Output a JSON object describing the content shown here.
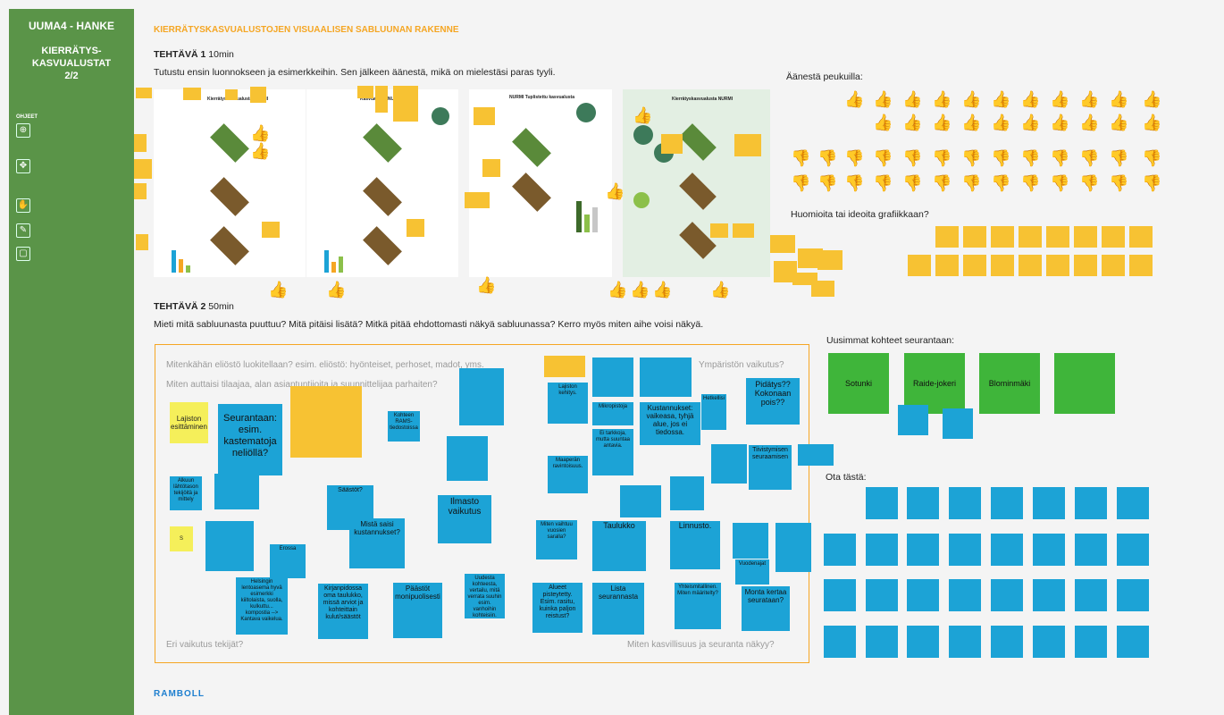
{
  "sidebar": {
    "title": "UUMA4 - HANKE",
    "subtitle_line1": "KIERRÄTYS-",
    "subtitle_line2": "KASVUALUSTAT",
    "subtitle_line3": "2/2",
    "ohjeet": "OHJEET"
  },
  "header": {
    "title": "KIERRÄTYSKASVUALUSTOJEN VISUAALISEN SABLUUNAN RAKENNE"
  },
  "task1": {
    "label": "TEHTÄVÄ 1",
    "time": "10min",
    "instruction": "Tutustu ensin luonnokseen ja esimerkkeihin. Sen jälkeen äänestä, mikä on mielestäsi paras tyyli."
  },
  "task2": {
    "label": "TEHTÄVÄ 2",
    "time": "50min",
    "instruction": "Mieti mitä sabluunasta puuttuu? Mitä pitäisi lisätä? Mitkä pitää ehdottomasti näkyä sabluunassa? Kerro myös miten aihe voisi näkyä."
  },
  "right": {
    "vote_label": "Äänestä peukuilla:",
    "ideas_label": "Huomioita tai ideoita grafiikkaan?",
    "tracking_label": "Uusimmat kohteet seurantaan:",
    "take_label": "Ota tästä:",
    "green_notes": [
      "Sotunki",
      "Raide-jokeri",
      "Blominmäki"
    ]
  },
  "task2_hints": {
    "h1": "Mitenkähän eliöstö luokitellaan? esim. eliöstö: hyönteiset, perhoset, madot, yms.",
    "h2": "Ympäristön vaikutus?",
    "h3": "Miten auttaisi tilaajaa, alan asiantuntijoita ja suunnittelijaa parhaiten?",
    "h4": "Eri vaikutus tekijät?",
    "h5": "Miten kasvillisuus ja seuranta näkyy?"
  },
  "task2_notes": {
    "lajiston": "Lajiston esittäminen",
    "seurantaan": "Seurantaan: esim. kastematoja neliöllä?",
    "ilmasto": "Ilmasto vaikutus",
    "mista": "Mistä saisi kustannukset?",
    "paastot": "Päästöt monipuolisesti",
    "kirjanpidossa": "Kirjanpidossa oma taulukko, missä arviot ja kohteittain kulut/säästöt",
    "alueet": "Alueet pisteytetty. Esim. rasitu, kuinka paljon reistust?",
    "lista": "Lista seurannasta",
    "taulukko": "Taulukko",
    "linnusto": "Linnusto.",
    "monta": "Monta kertaa seurataan?",
    "kustannukset": "Kustannukset: vaikeasa, tyhjä alue, jos ei tiedossa.",
    "pidatys": "Pidätys?? Kokonaan pois??",
    "saastot": "Säästöt?",
    "helsingin": "Helsingin lentoasema hyvä esimerkki kiiltolaista, suolla, kulkuttu... kompostia --> Kantava vaikelua.",
    "lajiston_kehitys": "Lajiston kehitys.",
    "maaperan": "Maaperän ravintoisuus.",
    "mikropistoja": "Mikropistoja",
    "tiivistymisen": "Tiivistymisen seuraamisen",
    "miten_vaihtuu": "Miten vaihtuu vuosien saralla?",
    "yhteismitallinen": "Yhteismitallinen. Miten määritelty?",
    "vuodenajat": "Vuodenajat",
    "hetkellinen": "Hetkellisi",
    "pienet": "S",
    "erossa": "Erossa",
    "kohteen": "Kohteen RAMS-tiedostoissa",
    "alkuun": "Alkuun lähtötason tekijöitä ja mittely",
    "uudesta": "Uudesta kohteesta, vertailu, mitä verrata suuhin esim. vanhoihin kohteisiin.",
    "rakennusaika": "Ei tarkkoja, mutta suuntaa antavia."
  },
  "task1_panels": {
    "p1_title": "Kierrätyskasvualusta NURMI",
    "p2_title": "Kasvualusta NURMI",
    "p3_title": "NURMI Tuplistettu kasvualusta",
    "p4_title": "Kierrätyskasvualusta NURMI"
  },
  "logo": "RAMBOLL",
  "colors": {
    "sidebar": "#5a9448",
    "accent": "#f5a623",
    "sticky_yellow": "#f7c233",
    "sticky_blue": "#1ca3d6",
    "sticky_green": "#3fb53a",
    "thumb_up": "#4a9a2e",
    "thumb_down": "#e8245a"
  }
}
